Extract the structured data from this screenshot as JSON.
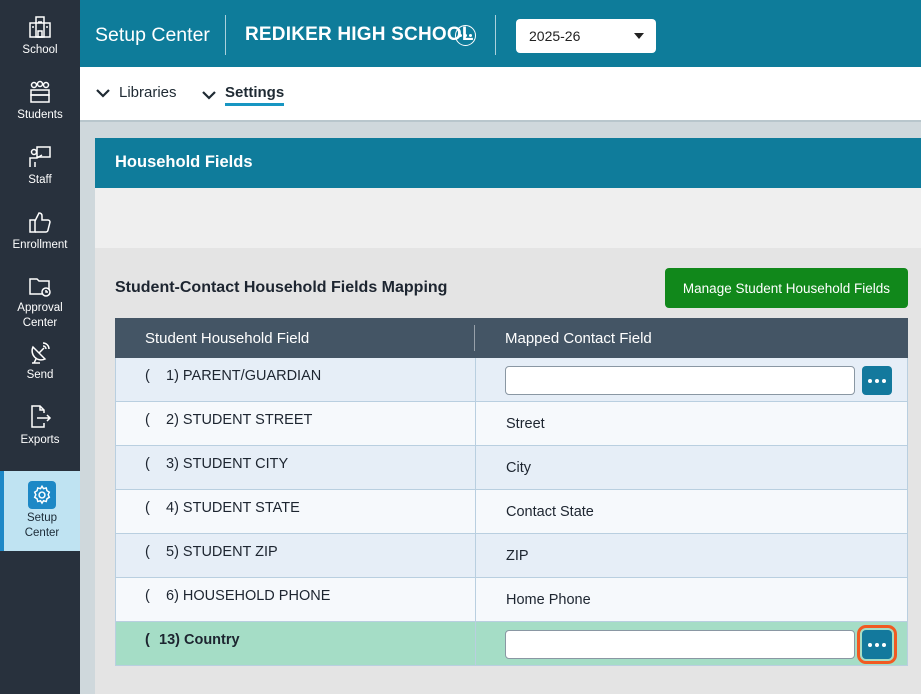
{
  "sidebar": {
    "items": [
      {
        "label": "School",
        "icon": "school-icon"
      },
      {
        "label": "Students",
        "icon": "students-icon"
      },
      {
        "label": "Staff",
        "icon": "staff-icon"
      },
      {
        "label": "Enrollment",
        "icon": "thumbs-up-icon"
      },
      {
        "label_line1": "Approval",
        "label_line2": "Center",
        "icon": "folder-clock-icon"
      },
      {
        "label": "Send",
        "icon": "satellite-dish-icon"
      },
      {
        "label": "Exports",
        "icon": "export-icon"
      },
      {
        "label_line1": "Setup",
        "label_line2": "Center",
        "icon": "gear-icon",
        "active": true
      }
    ]
  },
  "header": {
    "app_title": "Setup Center",
    "school_name": "REDIKER HIGH SCHOOL",
    "year": "2025-26"
  },
  "subnav": {
    "tabs": [
      {
        "label": "Libraries",
        "active": false
      },
      {
        "label": "Settings",
        "active": true
      }
    ]
  },
  "panel": {
    "title": "Household Fields",
    "section_title": "Student-Contact Household Fields Mapping",
    "manage_button": "Manage Student Household Fields"
  },
  "table": {
    "headers": [
      "Student Household Field",
      "Mapped Contact Field"
    ],
    "rows": [
      {
        "paren": "(",
        "field": "1) PARENT/GUARDIAN",
        "mapped": ""
      },
      {
        "paren": "(",
        "field": "2) STUDENT STREET",
        "mapped": "Street"
      },
      {
        "paren": "(",
        "field": "3) STUDENT CITY",
        "mapped": "City"
      },
      {
        "paren": "(",
        "field": "4) STUDENT STATE",
        "mapped": "Contact State"
      },
      {
        "paren": "(",
        "field": "5) STUDENT ZIP",
        "mapped": "ZIP"
      },
      {
        "paren": "(",
        "field": "6) HOUSEHOLD PHONE",
        "mapped": "Home Phone"
      },
      {
        "paren": "(",
        "field": "13) Country",
        "mapped": ""
      }
    ]
  },
  "colors": {
    "header_bg": "#0e7c9a",
    "sidebar_bg": "#28313d",
    "manage_button_bg": "#11881b",
    "highlight_row_bg": "#a5ddc6",
    "focus_outline": "#f15a22"
  }
}
